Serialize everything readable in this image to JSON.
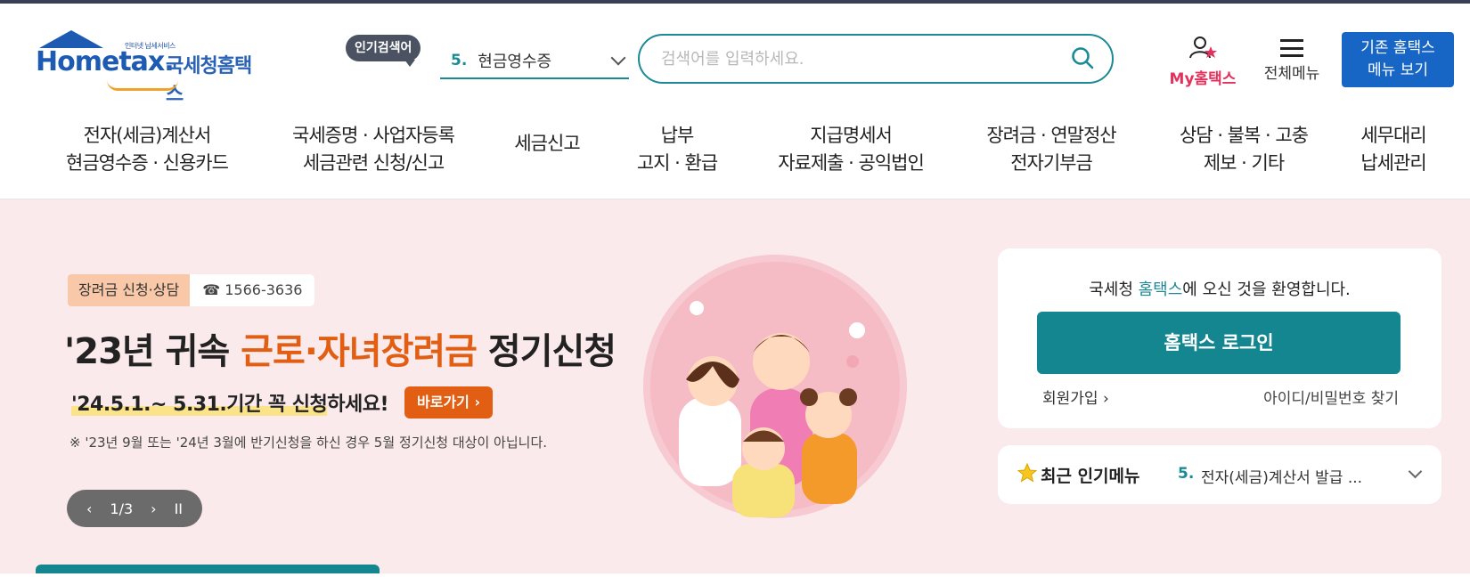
{
  "header": {
    "logo_tagline": "인터넷 납세서비스",
    "logo_brand": "Hometax.",
    "logo_brand_kr": "국세청홈택스",
    "popular_label": "인기검색어",
    "popular_rank": "5.",
    "popular_value": "현금영수증",
    "search_placeholder": "검색어를 입력하세요.",
    "my_hometax": "My홈택스",
    "all_menu": "전체메뉴",
    "legacy_line1": "기존 홈택스",
    "legacy_line2": "메뉴 보기"
  },
  "gnb": [
    {
      "line1": "전자(세금)계산서",
      "line2": "현금영수증 · 신용카드"
    },
    {
      "line1": "국세증명 · 사업자등록",
      "line2": "세금관련 신청/신고"
    },
    {
      "line1": "세금신고",
      "line2": ""
    },
    {
      "line1": "납부",
      "line2": "고지 · 환급"
    },
    {
      "line1": "지급명세서",
      "line2": "자료제출 · 공익법인"
    },
    {
      "line1": "장려금 · 연말정산",
      "line2": "전자기부금"
    },
    {
      "line1": "상담 · 불복 · 고충",
      "line2": "제보 · 기타"
    },
    {
      "line1": "세무대리",
      "line2": "납세관리"
    }
  ],
  "banner": {
    "tag": "장려금 신청·상담",
    "phone": "☎ 1566-3636",
    "title_pre": "'23년 귀속 ",
    "title_hl": "근로·자녀장려금",
    "title_post": " 정기신청",
    "sub_under": "'24.5.1.~ 5.31.기간 꼭 신청",
    "sub_rest": "하세요!",
    "goto": "바로가기 ›",
    "note": "※ '23년 9월 또는 '24년 3월에 반기신청을 하신 경우 5월 정기신청 대상이 아닙니다.",
    "slider_prev": "‹",
    "slider_pos": "1/3",
    "slider_next": "›",
    "slider_pause": "II"
  },
  "login": {
    "welcome_pre": "국세청 ",
    "welcome_accent": "홈택스",
    "welcome_post": "에 오신 것을 환영합니다.",
    "login_button": "홈택스 로그인",
    "signup": "회원가입 ›",
    "find_id": "아이디/비밀번호 찾기"
  },
  "recent": {
    "title": "최근 인기메뉴",
    "rank": "5.",
    "value": "전자(세금)계산서 발급 ..."
  },
  "colors": {
    "accent": "#1b8a94",
    "brand": "#1d5bb3",
    "banner_bg": "#fbeaec",
    "highlight": "#e25e12"
  }
}
